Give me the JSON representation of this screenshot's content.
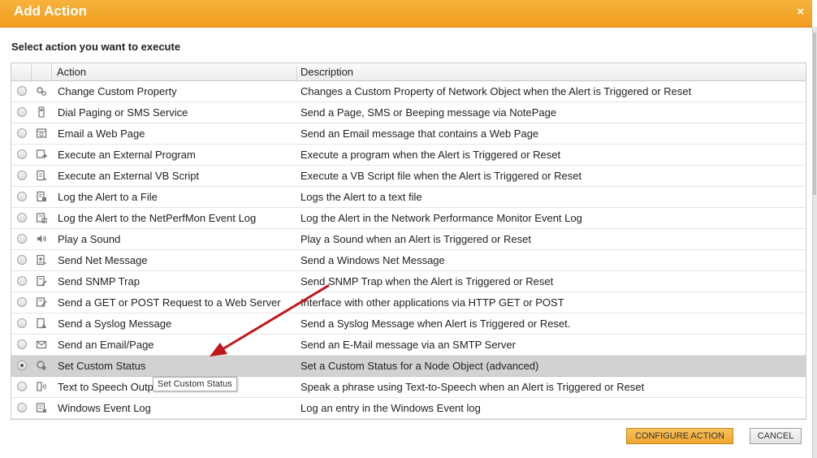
{
  "dialog": {
    "title": "Add Action",
    "close_glyph": "×",
    "subtitle": "Select action you want to execute"
  },
  "table": {
    "headers": {
      "action": "Action",
      "description": "Description"
    },
    "rows": [
      {
        "action": "Change Custom Property",
        "description": "Changes a Custom Property of Network Object when the Alert is Triggered or Reset",
        "icon": "gears-icon",
        "selected": false
      },
      {
        "action": "Dial Paging or SMS Service",
        "description": "Send a Page, SMS or Beeping message via NotePage",
        "icon": "pager-icon",
        "selected": false
      },
      {
        "action": "Email a Web Page",
        "description": "Send an Email message that contains a Web Page",
        "icon": "web-page-icon",
        "selected": false
      },
      {
        "action": "Execute an External Program",
        "description": "Execute a program when the Alert is Triggered or Reset",
        "icon": "program-icon",
        "selected": false
      },
      {
        "action": "Execute an External VB Script",
        "description": "Execute a VB Script file when the Alert is Triggered or Reset",
        "icon": "script-icon",
        "selected": false
      },
      {
        "action": "Log the Alert to a File",
        "description": "Logs the Alert to a text file",
        "icon": "log-file-icon",
        "selected": false
      },
      {
        "action": "Log the Alert to the NetPerfMon Event Log",
        "description": "Log the Alert in the Network Performance Monitor Event Log",
        "icon": "event-log-icon",
        "selected": false
      },
      {
        "action": "Play a Sound",
        "description": "Play a Sound when an Alert is Triggered or Reset",
        "icon": "speaker-icon",
        "selected": false
      },
      {
        "action": "Send Net Message",
        "description": "Send a Windows Net Message",
        "icon": "net-message-icon",
        "selected": false
      },
      {
        "action": "Send SNMP Trap",
        "description": "Send SNMP Trap when the Alert is Triggered or Reset",
        "icon": "snmp-icon",
        "selected": false
      },
      {
        "action": "Send a GET or POST Request to a Web Server",
        "description": "Interface with other applications via HTTP GET or POST",
        "icon": "http-icon",
        "selected": false
      },
      {
        "action": "Send a Syslog Message",
        "description": "Send a Syslog Message when Alert is Triggered or Reset.",
        "icon": "syslog-icon",
        "selected": false
      },
      {
        "action": "Send an Email/Page",
        "description": "Send an E-Mail message via an SMTP Server",
        "icon": "envelope-icon",
        "selected": false
      },
      {
        "action": "Set Custom Status",
        "description": "Set a Custom Status for a Node Object (advanced)",
        "icon": "custom-status-icon",
        "selected": true
      },
      {
        "action": "Text to Speech Output",
        "description": "Speak a phrase using Text-to-Speech when an Alert is Triggered or Reset",
        "icon": "text-to-speech-icon",
        "selected": false
      },
      {
        "action": "Windows Event Log",
        "description": "Log an entry in the Windows Event log",
        "icon": "windows-log-icon",
        "selected": false
      }
    ]
  },
  "tooltip": {
    "text": "Set Custom Status"
  },
  "buttons": {
    "configure": "CONFIGURE ACTION",
    "cancel": "CANCEL"
  },
  "colors": {
    "title_bar": "#f09c1e",
    "selected_row": "#d2d2d2",
    "annotation_arrow": "#c0171b",
    "configure_button": "#eea531"
  }
}
